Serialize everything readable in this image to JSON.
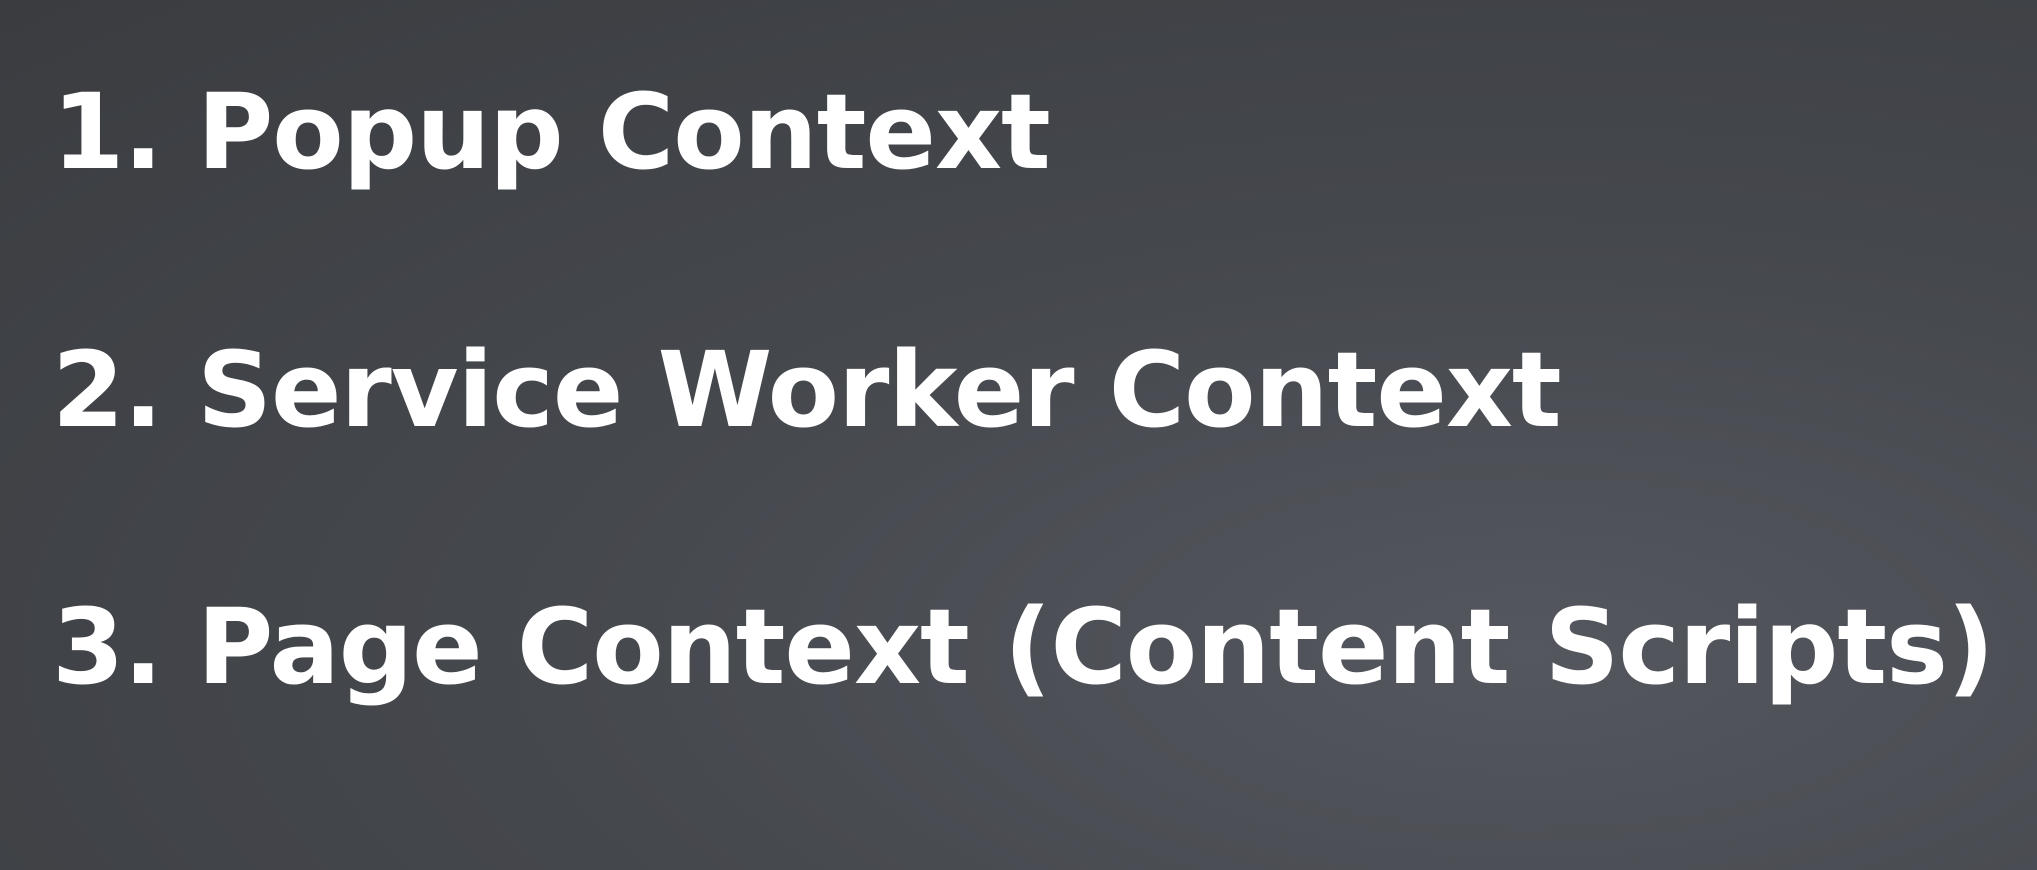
{
  "slide": {
    "items": [
      {
        "text": "1. Popup Context"
      },
      {
        "text": "2. Service Worker Context"
      },
      {
        "text": "3. Page Context (Content Scripts)"
      }
    ]
  },
  "colors": {
    "background": "#45484d",
    "text": "#ffffff"
  }
}
